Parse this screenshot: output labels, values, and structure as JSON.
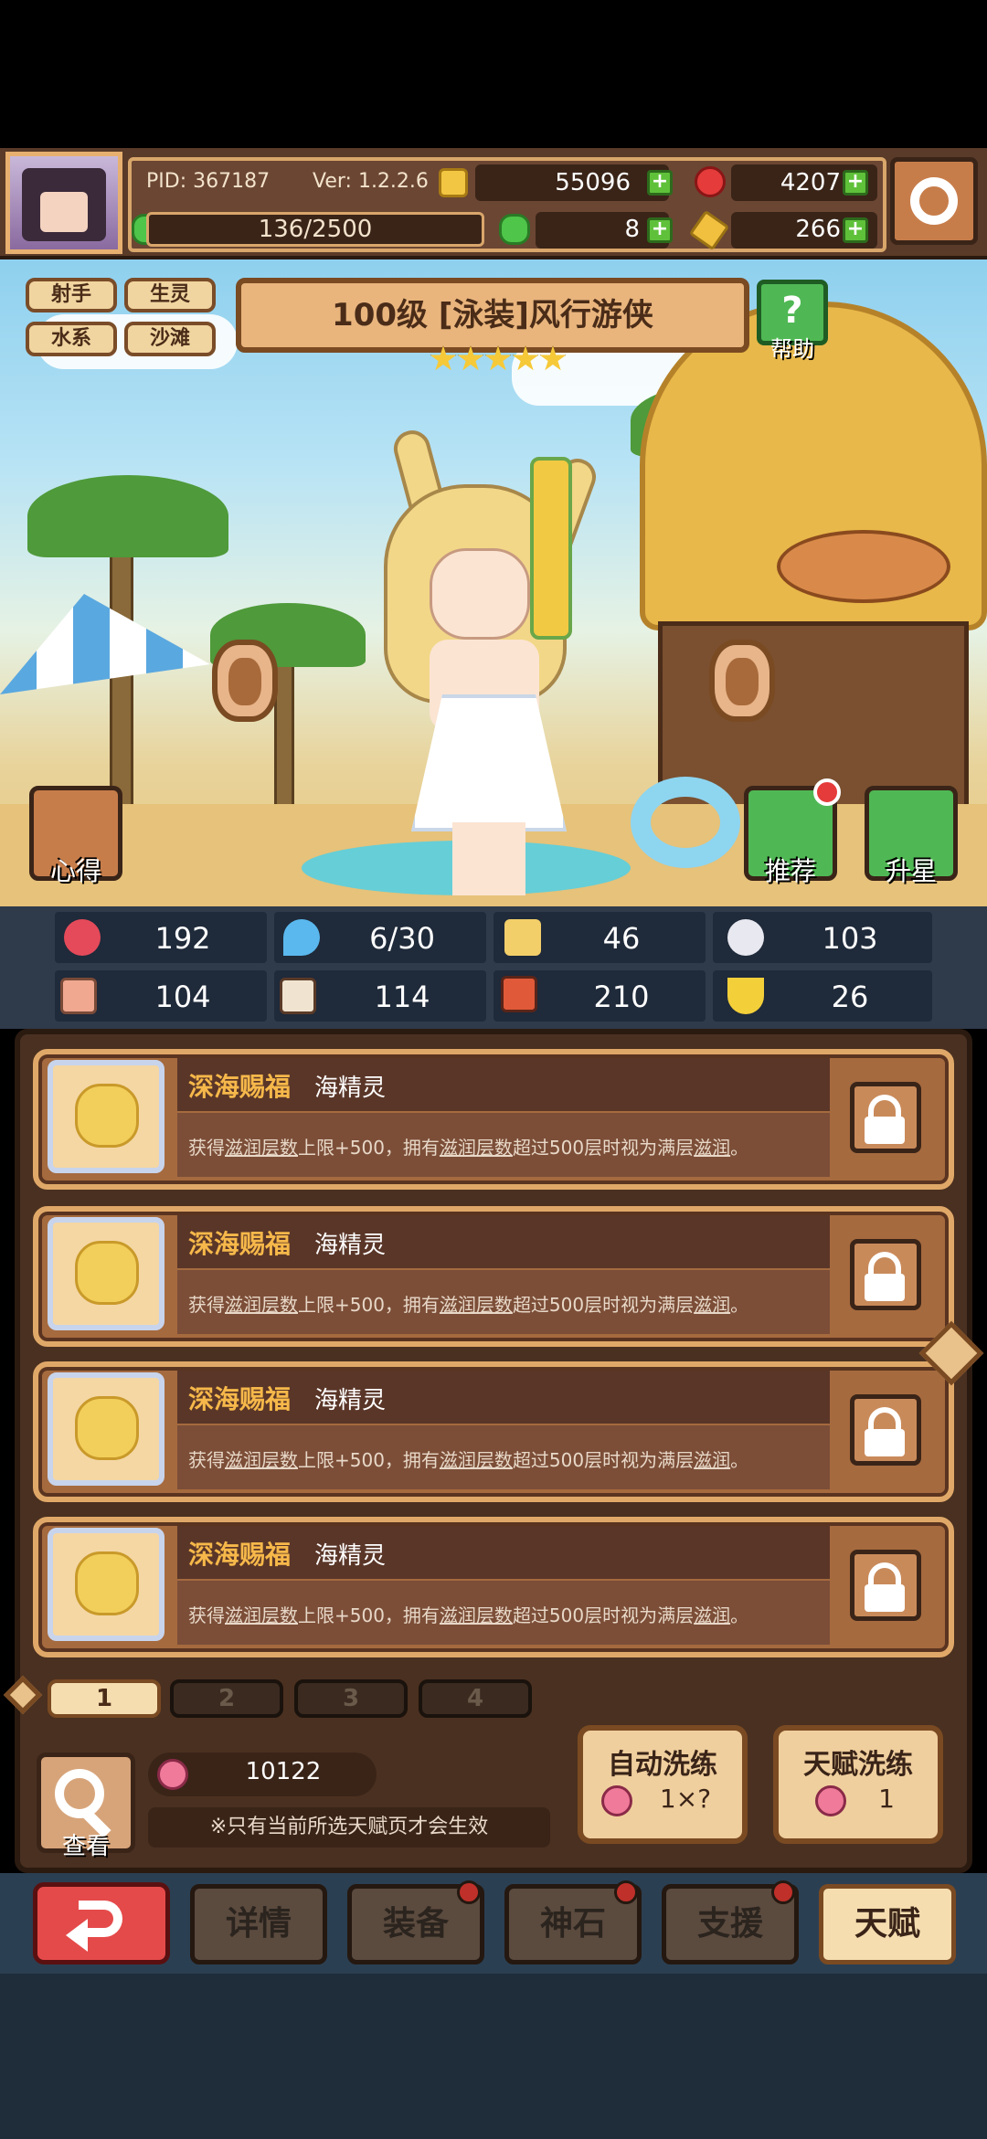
{
  "header": {
    "pid": "PID: 367187",
    "version": "Ver: 1.2.2.6",
    "gold": "55096",
    "ruby": "4207",
    "stamina": "136/2500",
    "clover": "8",
    "keys": "266"
  },
  "hero": {
    "tags": [
      "射手",
      "生灵",
      "水系",
      "沙滩"
    ],
    "title": "100级  [泳装]风行游侠",
    "stars": 5,
    "help_label": "帮助",
    "left_button_label": "心得",
    "recommend_label": "推荐",
    "star_up_label": "升星"
  },
  "stats": {
    "hp": "192",
    "mana": "6/30",
    "defense": "46",
    "speed": "103",
    "attack": "104",
    "magic": "114",
    "power": "210",
    "luck": "26"
  },
  "talents": [
    {
      "name": "深海赐福",
      "source": "海精灵",
      "desc_parts": [
        "获得",
        "滋润层数",
        "上限+500，拥有",
        "滋润层数",
        "超过500层时视为满层",
        "滋润",
        "。"
      ]
    },
    {
      "name": "深海赐福",
      "source": "海精灵",
      "desc_parts": [
        "获得",
        "滋润层数",
        "上限+500，拥有",
        "滋润层数",
        "超过500层时视为满层",
        "滋润",
        "。"
      ]
    },
    {
      "name": "深海赐福",
      "source": "海精灵",
      "desc_parts": [
        "获得",
        "滋润层数",
        "上限+500，拥有",
        "滋润层数",
        "超过500层时视为满层",
        "滋润",
        "。"
      ]
    },
    {
      "name": "深海赐福",
      "source": "海精灵",
      "desc_parts": [
        "获得",
        "滋润层数",
        "上限+500，拥有",
        "滋润层数",
        "超过500层时视为满层",
        "滋润",
        "。"
      ]
    }
  ],
  "pages": [
    "1",
    "2",
    "3",
    "4"
  ],
  "active_page": "1",
  "bottom_panel": {
    "view_label": "查看",
    "fruit_count": "10122",
    "note": "※只有当前所选天赋页才会生效",
    "auto_refine_title": "自动洗练",
    "auto_refine_cost": "1×?",
    "talent_refine_title": "天赋洗练",
    "talent_refine_cost": "1"
  },
  "nav": {
    "details": "详情",
    "equipment": "装备",
    "godstone": "神石",
    "support": "支援",
    "talent": "天赋"
  },
  "colors": {
    "accent_orange": "#f6b84a",
    "panel_brown": "#a56a3e",
    "plus_green": "#5fc13a",
    "alert_red": "#e53b3b"
  },
  "icons": {
    "gold": "coin-icon",
    "ruby": "ruby-icon",
    "clover": "clover-icon",
    "key": "key-icon",
    "settings": "gear-icon",
    "lock": "unlocked-padlock-icon",
    "view": "magnifier-icon",
    "back": "return-arrow-icon"
  }
}
